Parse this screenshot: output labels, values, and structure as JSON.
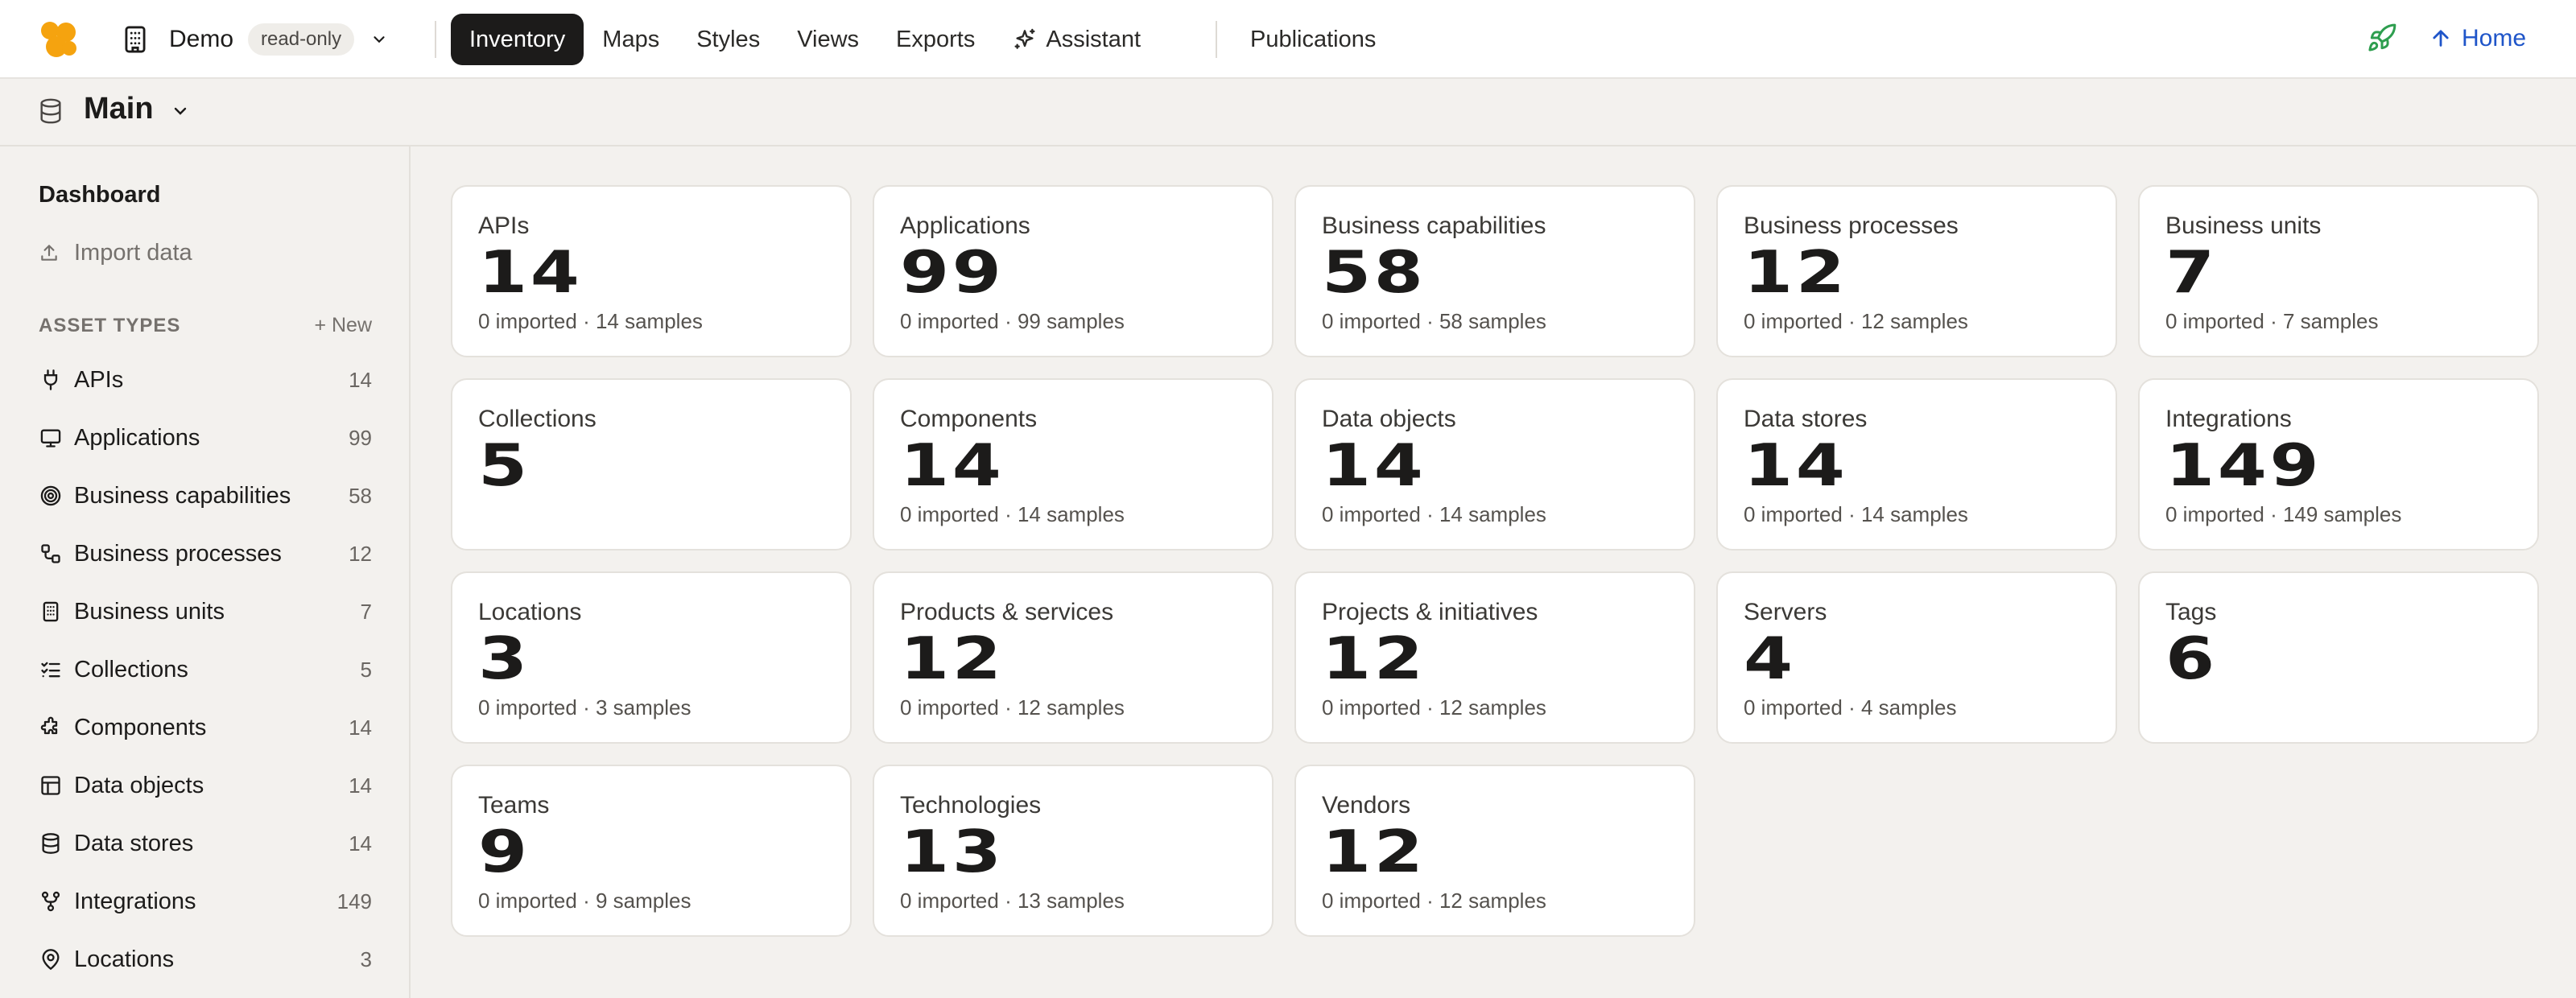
{
  "workspace": {
    "name": "Demo",
    "badge": "read-only"
  },
  "nav": {
    "items": [
      {
        "label": "Inventory",
        "active": true
      },
      {
        "label": "Maps"
      },
      {
        "label": "Styles"
      },
      {
        "label": "Views"
      },
      {
        "label": "Exports"
      },
      {
        "label": "Assistant",
        "icon": "sparkle-icon"
      }
    ],
    "publications": "Publications",
    "home": "Home"
  },
  "header": {
    "title": "Main"
  },
  "sidebar": {
    "dashboard": "Dashboard",
    "import": "Import data",
    "section_label": "ASSET TYPES",
    "new_label": "+ New",
    "items": [
      {
        "label": "APIs",
        "count": "14",
        "icon": "plug-icon"
      },
      {
        "label": "Applications",
        "count": "99",
        "icon": "monitor-icon"
      },
      {
        "label": "Business capabilities",
        "count": "58",
        "icon": "target-icon"
      },
      {
        "label": "Business processes",
        "count": "12",
        "icon": "workflow-icon"
      },
      {
        "label": "Business units",
        "count": "7",
        "icon": "building-icon"
      },
      {
        "label": "Collections",
        "count": "5",
        "icon": "checklist-icon"
      },
      {
        "label": "Components",
        "count": "14",
        "icon": "puzzle-icon"
      },
      {
        "label": "Data objects",
        "count": "14",
        "icon": "table-icon"
      },
      {
        "label": "Data stores",
        "count": "14",
        "icon": "database-icon"
      },
      {
        "label": "Integrations",
        "count": "149",
        "icon": "git-merge-icon"
      },
      {
        "label": "Locations",
        "count": "3",
        "icon": "map-pin-icon"
      }
    ]
  },
  "cards": [
    {
      "title": "APIs",
      "value": "14",
      "meta": "0 imported · 14 samples"
    },
    {
      "title": "Applications",
      "value": "99",
      "meta": "0 imported · 99 samples"
    },
    {
      "title": "Business capabilities",
      "value": "58",
      "meta": "0 imported · 58 samples"
    },
    {
      "title": "Business processes",
      "value": "12",
      "meta": "0 imported · 12 samples"
    },
    {
      "title": "Business units",
      "value": "7",
      "meta": "0 imported · 7 samples"
    },
    {
      "title": "Collections",
      "value": "5",
      "meta": ""
    },
    {
      "title": "Components",
      "value": "14",
      "meta": "0 imported · 14 samples"
    },
    {
      "title": "Data objects",
      "value": "14",
      "meta": "0 imported · 14 samples"
    },
    {
      "title": "Data stores",
      "value": "14",
      "meta": "0 imported · 14 samples"
    },
    {
      "title": "Integrations",
      "value": "149",
      "meta": "0 imported · 149 samples"
    },
    {
      "title": "Locations",
      "value": "3",
      "meta": "0 imported · 3 samples"
    },
    {
      "title": "Products & services",
      "value": "12",
      "meta": "0 imported · 12 samples"
    },
    {
      "title": "Projects & initiatives",
      "value": "12",
      "meta": "0 imported · 12 samples"
    },
    {
      "title": "Servers",
      "value": "4",
      "meta": "0 imported · 4 samples"
    },
    {
      "title": "Tags",
      "value": "6",
      "meta": ""
    },
    {
      "title": "Teams",
      "value": "9",
      "meta": "0 imported · 9 samples"
    },
    {
      "title": "Technologies",
      "value": "13",
      "meta": "0 imported · 13 samples"
    },
    {
      "title": "Vendors",
      "value": "12",
      "meta": "0 imported · 12 samples"
    }
  ],
  "colors": {
    "accent": "#1c1b1a",
    "logo": "#f5a30f",
    "link": "#1f55c9",
    "rocket": "#2e9e4f",
    "background": "#f3f1ee"
  }
}
